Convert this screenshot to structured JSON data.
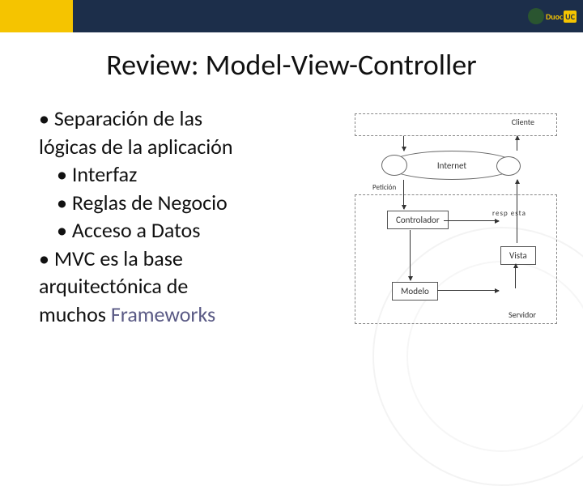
{
  "header": {
    "logo_duoc": "Duoc",
    "logo_uc": "UC"
  },
  "title": "Review: Model-View-Controller",
  "bullets": {
    "item1_line1": "• Separación de las",
    "item1_line2": "lógicas de la aplicación",
    "sub1": "• Interfaz",
    "sub2": "• Reglas de Negocio",
    "sub3": "• Acceso a Datos",
    "item2_line1": "• MVC es la base",
    "item2_line2": "arquitectónica de",
    "item2_line3_pre": "muchos ",
    "item2_line3_fw": "Frameworks"
  },
  "diagram": {
    "cliente": "Cliente",
    "servidor": "Servidor",
    "internet": "Internet",
    "controlador": "Controlador",
    "modelo": "Modelo",
    "vista": "Vista",
    "peticion": "Petición",
    "respuesta": "resp esta"
  }
}
